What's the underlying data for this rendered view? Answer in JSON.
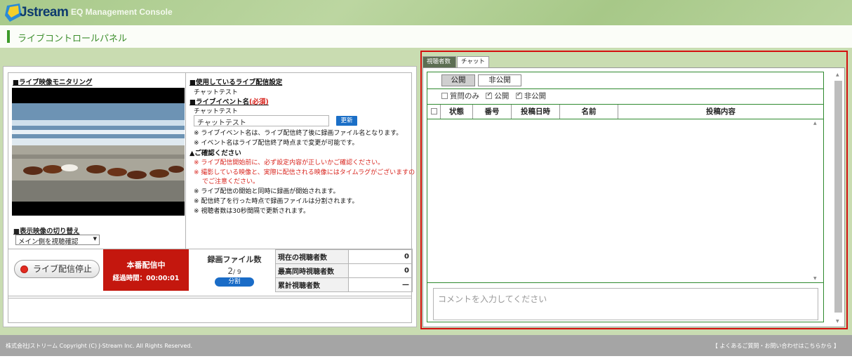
{
  "header": {
    "logo_text": "Jstream",
    "console_title": "EQ Management Console",
    "page_title": "ライブコントロールパネル"
  },
  "left": {
    "monitor_heading": "■ライブ映像モニタリング",
    "switch_heading": "■表示映像の切り替え",
    "switch_select": "メイン側を視聴確認",
    "settings_heading": "■使用しているライブ配信設定",
    "settings_value": "チャットテスト",
    "event_heading": "■ライブイベント名",
    "event_required": "(必須)",
    "event_current": "チャットテスト",
    "event_input_value": "チャットテスト",
    "update_button": "更新",
    "note1": "※ ライブイベント名は、ライブ配信終了後に録画ファイル名となります。",
    "note2": "※ イベント名はライブ配信終了時点まで変更が可能です。",
    "confirm_heading": "▲ご確認ください",
    "red1": "※ ライブ配信開始前に、必ず設定内容が正しいかご確認ください。",
    "red2": "※ 撮影している映像と、実際に配信される映像にはタイムラグがございますの",
    "red3": "でご注意ください。",
    "info1": "※ ライブ配信の開始と同時に録画が開始されます。",
    "info2": "※ 配信終了を行った時点で録画ファイルは分割されます。",
    "info3": "※ 視聴者数は30秒間隔で更新されます。",
    "stop_button": "ライブ配信停止",
    "live_status": "本番配信中",
    "elapsed": "経過時間：00:00:01",
    "files_title": "録画ファイル数",
    "files_count": "2",
    "files_total": "/ 9",
    "split_button": "分割",
    "stats": [
      {
        "label": "現在の視聴者数",
        "value": "0"
      },
      {
        "label": "最高同時視聴者数",
        "value": "0"
      },
      {
        "label": "累計視聴者数",
        "value": "—"
      }
    ]
  },
  "right": {
    "tabs": [
      "視聴者数",
      "チャット"
    ],
    "seg_public": "公開",
    "seg_private": "非公開",
    "filter_question": "質問のみ",
    "filter_public": "公開",
    "filter_private": "非公開",
    "columns": [
      "状態",
      "番号",
      "投稿日時",
      "名前",
      "投稿内容"
    ],
    "comment_placeholder": "コメントを入力してください"
  },
  "footer": {
    "copyright": "株式会社Jストリーム  Copyright (C) J-Stream Inc. All Rights Reserved.",
    "faq": "【 よくあるご質問・お問い合わせはこちらから 】"
  },
  "colors": {
    "brand_green": "#3d9a2a",
    "live_red": "#c4170e",
    "button_blue": "#1b6fc7",
    "highlight_red": "#d40f0f"
  }
}
